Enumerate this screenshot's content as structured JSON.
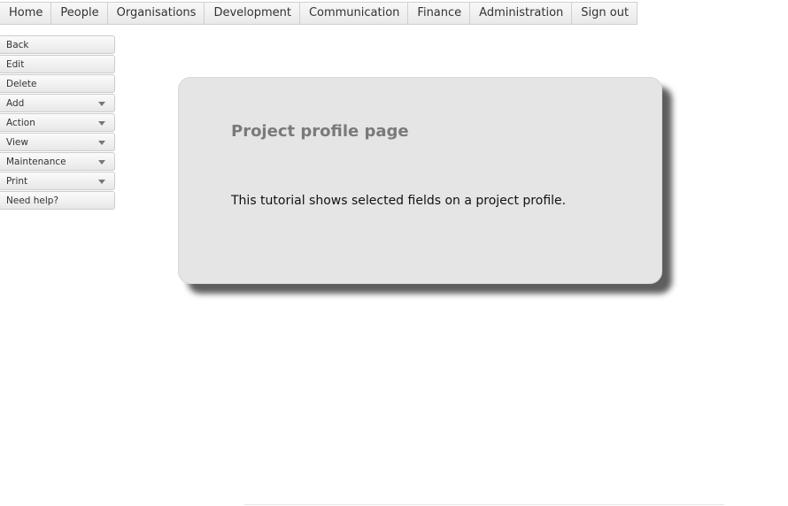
{
  "nav": {
    "items": [
      {
        "label": "Home"
      },
      {
        "label": "People"
      },
      {
        "label": "Organisations"
      },
      {
        "label": "Development"
      },
      {
        "label": "Communication"
      },
      {
        "label": "Finance"
      },
      {
        "label": "Administration"
      },
      {
        "label": "Sign out"
      }
    ]
  },
  "sidebar": {
    "items": [
      {
        "label": "Back",
        "dropdown": false
      },
      {
        "label": "Edit",
        "dropdown": false
      },
      {
        "label": "Delete",
        "dropdown": false
      },
      {
        "label": "Add",
        "dropdown": true
      },
      {
        "label": "Action",
        "dropdown": true
      },
      {
        "label": "View",
        "dropdown": true
      },
      {
        "label": "Maintenance",
        "dropdown": true
      },
      {
        "label": "Print",
        "dropdown": true
      },
      {
        "label": "Need help?",
        "dropdown": false
      }
    ]
  },
  "card": {
    "title": "Project profile page",
    "text": "This tutorial shows selected fields on a project profile."
  },
  "colors": {
    "card_background": "#e5e5e5",
    "title_text": "#7a7a7a",
    "shadow": "#5e5e5e"
  }
}
